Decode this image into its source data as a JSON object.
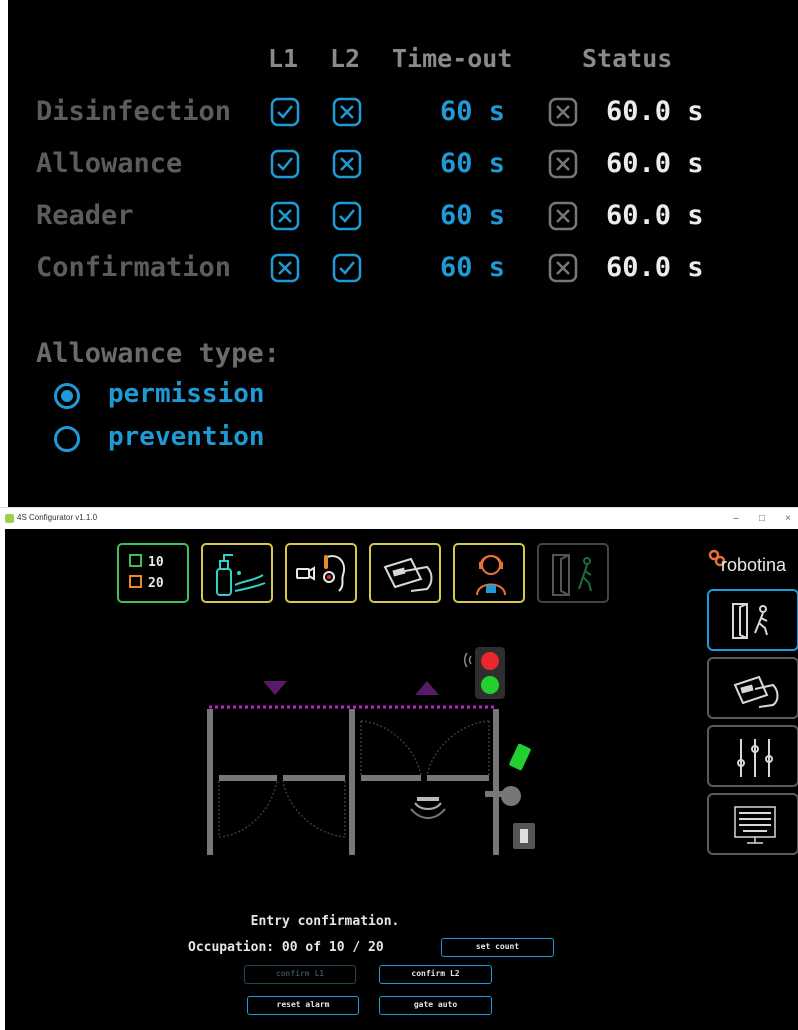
{
  "panel": {
    "headers": {
      "l1": "L1",
      "l2": "L2",
      "timeout": "Time-out",
      "status": "Status"
    },
    "rows": [
      {
        "label": "Disinfection",
        "l1": true,
        "l2": false,
        "timeout": "60 s",
        "status_checked": false,
        "status": "60.0 s"
      },
      {
        "label": "Allowance",
        "l1": true,
        "l2": false,
        "timeout": "60 s",
        "status_checked": false,
        "status": "60.0 s"
      },
      {
        "label": "Reader",
        "l1": false,
        "l2": true,
        "timeout": "60 s",
        "status_checked": false,
        "status": "60.0 s"
      },
      {
        "label": "Confirmation",
        "l1": false,
        "l2": true,
        "timeout": "60 s",
        "status_checked": false,
        "status": "60.0 s"
      }
    ],
    "allowance_type_label": "Allowance type:",
    "allowance_options": [
      {
        "label": "permission",
        "selected": true
      },
      {
        "label": "prevention",
        "selected": false
      }
    ]
  },
  "window": {
    "title": "4S Configurator v1.1.0",
    "controls": {
      "minimize": "–",
      "maximize": "□",
      "close": "×"
    }
  },
  "toolbar": {
    "counter": {
      "limit1": "10",
      "limit2": "20"
    },
    "tools": [
      "disinfection-tool",
      "allowance-tool",
      "reader-tool",
      "confirmation-tool",
      "exit-tool"
    ]
  },
  "brand": {
    "logo_text": "robotina"
  },
  "sidebar": {
    "items": [
      "gate-view",
      "card-reader",
      "settings-sliders",
      "keyboard"
    ]
  },
  "status": {
    "message": "Entry confirmation.",
    "occupation": "Occupation: 00 of 10 / 20"
  },
  "buttons": {
    "set_count": "set count",
    "confirm_l1": "confirm L1",
    "confirm_l2": "confirm L2",
    "reset_alarm": "reset alarm",
    "gate_auto": "gate auto"
  },
  "colors": {
    "accent_blue": "#1e9ad6",
    "tool_border": "#d8c84a",
    "counter_border": "#3fbf5c",
    "light_red": "#e8282e",
    "light_green": "#22d12f",
    "marker_purple": "#5a1a6a"
  }
}
